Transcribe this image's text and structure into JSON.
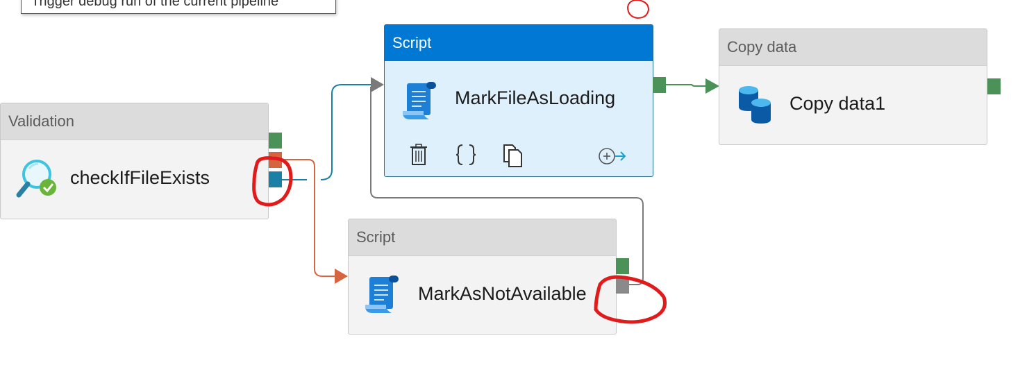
{
  "tooltip": {
    "text": "Trigger debug run of the current pipeline"
  },
  "activities": {
    "validation": {
      "type_label": "Validation",
      "name": "checkIfFileExists"
    },
    "script1": {
      "type_label": "Script",
      "name": "MarkFileAsLoading"
    },
    "script2": {
      "type_label": "Script",
      "name": "MarkAsNotAvailable"
    },
    "copy": {
      "type_label": "Copy data",
      "name": "Copy data1"
    }
  },
  "colors": {
    "accent": "#0078d4",
    "success": "#4a9258",
    "failure": "#d6653f",
    "completion": "#1a80a6",
    "skipped": "#8a8a8a",
    "annotation": "#e01b1b"
  },
  "icons": {
    "validation": "magnifier-check-icon",
    "script": "script-scroll-icon",
    "copy": "database-copy-icon",
    "delete": "trash-icon",
    "code": "braces-icon",
    "clone": "copy-icon",
    "add_output": "add-output-icon"
  }
}
